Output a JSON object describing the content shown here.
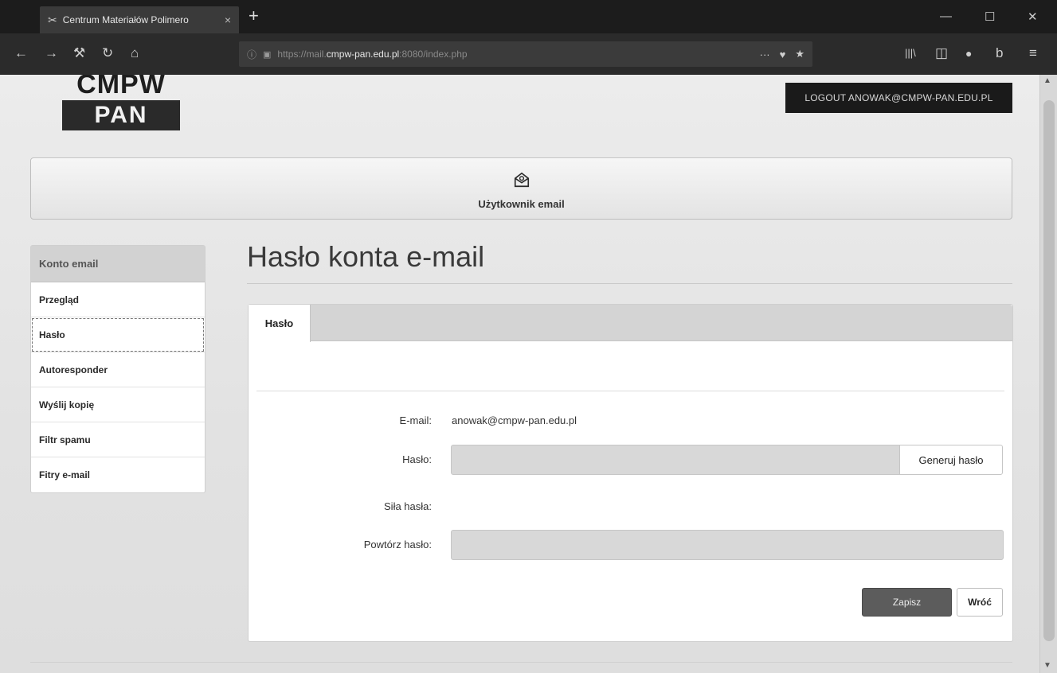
{
  "browser": {
    "tab_icon": "tools-icon",
    "tab_title": "Centrum Materiałów Polimero",
    "tab_close": "×",
    "new_tab": "+",
    "window": {
      "minimize": "—",
      "maximize": "☐",
      "close": "✕"
    },
    "nav": {
      "back": "←",
      "forward": "→",
      "tools": "⚒",
      "reload": "↻",
      "home": "⌂"
    },
    "url": {
      "prefix": "https://mail.",
      "host": "cmpw-pan.edu.pl",
      "suffix": ":8080/index.php"
    },
    "url_actions": {
      "more": "···",
      "pocket": "♥",
      "bookmark": "★"
    },
    "toolbar": {
      "library": "|||\\",
      "sidebar": "◫",
      "extension1": "●",
      "extension2": "b",
      "menu": "≡"
    }
  },
  "header": {
    "logo_top": "CMPW",
    "logo_bottom": "PAN",
    "logout_label": "LOGOUT ANOWAK@CMPW-PAN.EDU.PL"
  },
  "banner": {
    "icon": "open-envelope-icon",
    "label": "Użytkownik email"
  },
  "sidebar": {
    "header": "Konto email",
    "items": [
      {
        "label": "Przegląd"
      },
      {
        "label": "Hasło"
      },
      {
        "label": "Autoresponder"
      },
      {
        "label": "Wyślij kopię"
      },
      {
        "label": "Filtr spamu"
      },
      {
        "label": "Fitry e-mail"
      }
    ],
    "active_index": 1
  },
  "main": {
    "title": "Hasło konta e-mail",
    "tab_label": "Hasło",
    "form": {
      "email_label": "E-mail:",
      "email_value": "anowak@cmpw-pan.edu.pl",
      "password_label": "Hasło:",
      "password_value": "",
      "generate_label": "Generuj hasło",
      "strength_label": "Siła hasła:",
      "repeat_label": "Powtórz hasło:",
      "repeat_value": ""
    },
    "save_label": "Zapisz",
    "back_label": "Wróć"
  },
  "scroll": {
    "up": "▲",
    "down": "▼"
  }
}
